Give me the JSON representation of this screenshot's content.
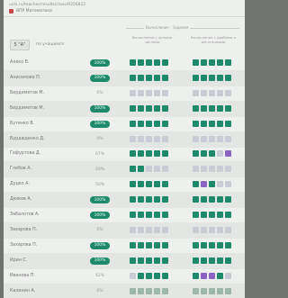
{
  "browser": {
    "url": "uchi.ru/teacher/results/class/9356822"
  },
  "app": {
    "title": "ВПР Математика"
  },
  "toolbar": {
    "class_label": "5 \"А\"",
    "sort_label": "по учащимся"
  },
  "table": {
    "group_title": "Вычисления · Задания",
    "columns": [
      "Вычисления с целыми числами",
      "Вычисления с дробями и десятичными"
    ]
  },
  "students": [
    {
      "name": "Алеко В.",
      "percent": "100%",
      "full": true,
      "cells": [
        "g",
        "g",
        "g",
        "g",
        "g",
        "g",
        "g",
        "g",
        "g",
        "g"
      ]
    },
    {
      "name": "Анисимова П.",
      "percent": "100%",
      "full": true,
      "cells": [
        "g",
        "g",
        "g",
        "g",
        "g",
        "g",
        "g",
        "g",
        "g",
        "g"
      ]
    },
    {
      "name": "Бердиметов М.",
      "percent": "0%",
      "full": false,
      "cells": [
        "e",
        "e",
        "e",
        "e",
        "e",
        "e",
        "e",
        "e",
        "e",
        "e"
      ]
    },
    {
      "name": "Бердиметов М.",
      "percent": "100%",
      "full": true,
      "cells": [
        "g",
        "g",
        "g",
        "g",
        "g",
        "g",
        "g",
        "g",
        "g",
        "g"
      ]
    },
    {
      "name": "Бутенко В.",
      "percent": "100%",
      "full": true,
      "cells": [
        "g",
        "g",
        "g",
        "g",
        "g",
        "g",
        "g",
        "g",
        "g",
        "g"
      ]
    },
    {
      "name": "Бурдюденко Д.",
      "percent": "0%",
      "full": false,
      "cells": [
        "e",
        "e",
        "e",
        "e",
        "e",
        "e",
        "e",
        "e",
        "e",
        "e"
      ]
    },
    {
      "name": "Гафуртова Д.",
      "percent": "67%",
      "full": false,
      "cells": [
        "g",
        "g",
        "g",
        "g",
        "g",
        "g",
        "g",
        "g",
        "e",
        "p"
      ]
    },
    {
      "name": "Глебов А.",
      "percent": "20%",
      "full": false,
      "cells": [
        "g",
        "g",
        "e",
        "e",
        "e",
        "e",
        "e",
        "e",
        "e",
        "e"
      ]
    },
    {
      "name": "Дудко А.",
      "percent": "50%",
      "full": false,
      "cells": [
        "g",
        "g",
        "g",
        "g",
        "g",
        "g",
        "p",
        "g",
        "e",
        "e"
      ]
    },
    {
      "name": "Дюжев А.",
      "percent": "100%",
      "full": true,
      "cells": [
        "g",
        "g",
        "g",
        "g",
        "g",
        "g",
        "g",
        "g",
        "g",
        "g"
      ]
    },
    {
      "name": "Забалотов А.",
      "percent": "100%",
      "full": true,
      "cells": [
        "g",
        "g",
        "g",
        "g",
        "g",
        "g",
        "g",
        "g",
        "g",
        "g"
      ]
    },
    {
      "name": "Захарова П.",
      "percent": "0%",
      "full": false,
      "cells": [
        "e",
        "e",
        "e",
        "e",
        "e",
        "e",
        "e",
        "e",
        "e",
        "e"
      ]
    },
    {
      "name": "Захарова П.",
      "percent": "100%",
      "full": true,
      "cells": [
        "g",
        "g",
        "g",
        "g",
        "g",
        "g",
        "g",
        "g",
        "g",
        "g"
      ]
    },
    {
      "name": "Ирин С.",
      "percent": "100%",
      "full": true,
      "cells": [
        "g",
        "g",
        "g",
        "g",
        "g",
        "g",
        "g",
        "g",
        "g",
        "g"
      ]
    },
    {
      "name": "Иванова П.",
      "percent": "42%",
      "full": false,
      "cells": [
        "e",
        "g",
        "g",
        "g",
        "g",
        "g",
        "p",
        "p",
        "g",
        "e"
      ]
    },
    {
      "name": "Калинин А.",
      "percent": "0%",
      "full": false,
      "cells": [
        "l",
        "l",
        "l",
        "l",
        "l",
        "l",
        "l",
        "l",
        "l",
        "l"
      ]
    }
  ]
}
